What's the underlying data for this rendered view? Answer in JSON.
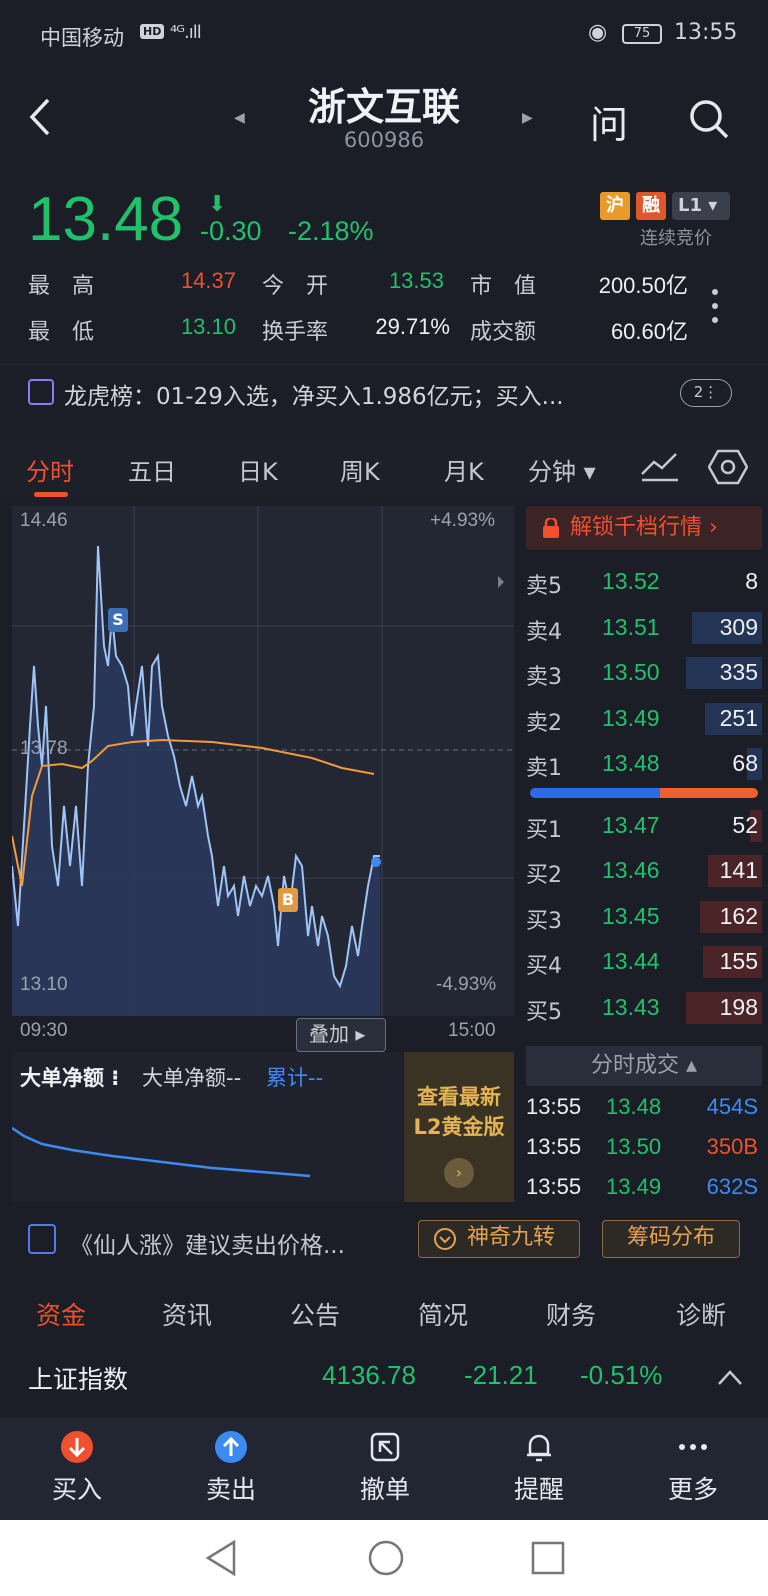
{
  "status": {
    "carrier": "中国移动",
    "hd": "HD",
    "signal": "⁴ᴳ.ıll",
    "battery": "75",
    "time": "13:55"
  },
  "header": {
    "title": "浙文互联",
    "code": "600986",
    "ask_label": "问"
  },
  "quote": {
    "price": "13.48",
    "change": "-0.30",
    "change_pct": "-2.18%",
    "tags": [
      "沪",
      "融",
      "L1"
    ],
    "session": "连续竞价",
    "stats": [
      {
        "label": "最　高",
        "value": "14.37"
      },
      {
        "label": "今　开",
        "value": "13.53"
      },
      {
        "label": "市　值",
        "value": "200.50亿"
      },
      {
        "label": "最　低",
        "value": "13.10"
      },
      {
        "label": "换手率",
        "value": "29.71%"
      },
      {
        "label": "成交额",
        "value": "60.60亿"
      }
    ]
  },
  "dragon": {
    "text": "龙虎榜：01-29入选，净买入1.986亿元；买入...",
    "badge": "2⋮"
  },
  "chart_tabs": [
    "分时",
    "五日",
    "日K",
    "周K",
    "月K",
    "分钟 ▾"
  ],
  "chart": {
    "y_top": "14.46",
    "y_mid": "13.78",
    "y_bottom": "13.10",
    "pct_top": "+4.93%",
    "pct_bottom": "-4.93%",
    "time_start": "09:30",
    "time_end": "15:00",
    "overlay": "叠加",
    "marker_s": "S",
    "marker_b": "B"
  },
  "chart_data": {
    "type": "line",
    "x": [
      "09:30",
      "15:00"
    ],
    "ylim": [
      13.1,
      14.46
    ],
    "series": [],
    "annotations": [
      "S",
      "B"
    ]
  },
  "orderbook": {
    "unlock": "解锁千档行情 ›",
    "asks": [
      {
        "label": "卖5",
        "price": "13.52",
        "vol": "8",
        "share": 0.0
      },
      {
        "label": "卖4",
        "price": "13.51",
        "vol": "309",
        "share": 0.92
      },
      {
        "label": "卖3",
        "price": "13.50",
        "vol": "335",
        "share": 1.0
      },
      {
        "label": "卖2",
        "price": "13.49",
        "vol": "251",
        "share": 0.75
      },
      {
        "label": "卖1",
        "price": "13.48",
        "vol": "68",
        "share": 0.2
      }
    ],
    "bids": [
      {
        "label": "买1",
        "price": "13.47",
        "vol": "52",
        "share": 0.16
      },
      {
        "label": "买2",
        "price": "13.46",
        "vol": "141",
        "share": 0.71
      },
      {
        "label": "买3",
        "price": "13.45",
        "vol": "162",
        "share": 0.82
      },
      {
        "label": "买4",
        "price": "13.44",
        "vol": "155",
        "share": 0.78
      },
      {
        "label": "买5",
        "price": "13.43",
        "vol": "198",
        "share": 1.0
      }
    ],
    "ticks_header": "分时成交 ▴",
    "ticks": [
      {
        "time": "13:55",
        "price": "13.48",
        "vol": "454S"
      },
      {
        "time": "13:55",
        "price": "13.50",
        "vol": "350B"
      },
      {
        "time": "13:55",
        "price": "13.49",
        "vol": "632S"
      }
    ]
  },
  "bigorder": {
    "title": "大单净额 ⁝",
    "sub": "大单净额--",
    "cum": "累计--",
    "l2": "查看最新\nL2黄金版"
  },
  "strategy": {
    "text": "《仙人涨》建议卖出价格...",
    "btn1": "神奇九转",
    "btn2": "筹码分布"
  },
  "bottom_tabs": [
    "资金",
    "资讯",
    "公告",
    "简况",
    "财务",
    "诊断"
  ],
  "index": {
    "name": "上证指数",
    "value": "4136.78",
    "change": "-21.21",
    "pct": "-0.51%"
  },
  "actions": [
    "买入",
    "卖出",
    "撤单",
    "提醒",
    "更多"
  ],
  "colors": {
    "up": "#f0502e",
    "down": "#1fc26b",
    "price_line": "#9fc4f5",
    "avg_line": "#f29b3a"
  }
}
